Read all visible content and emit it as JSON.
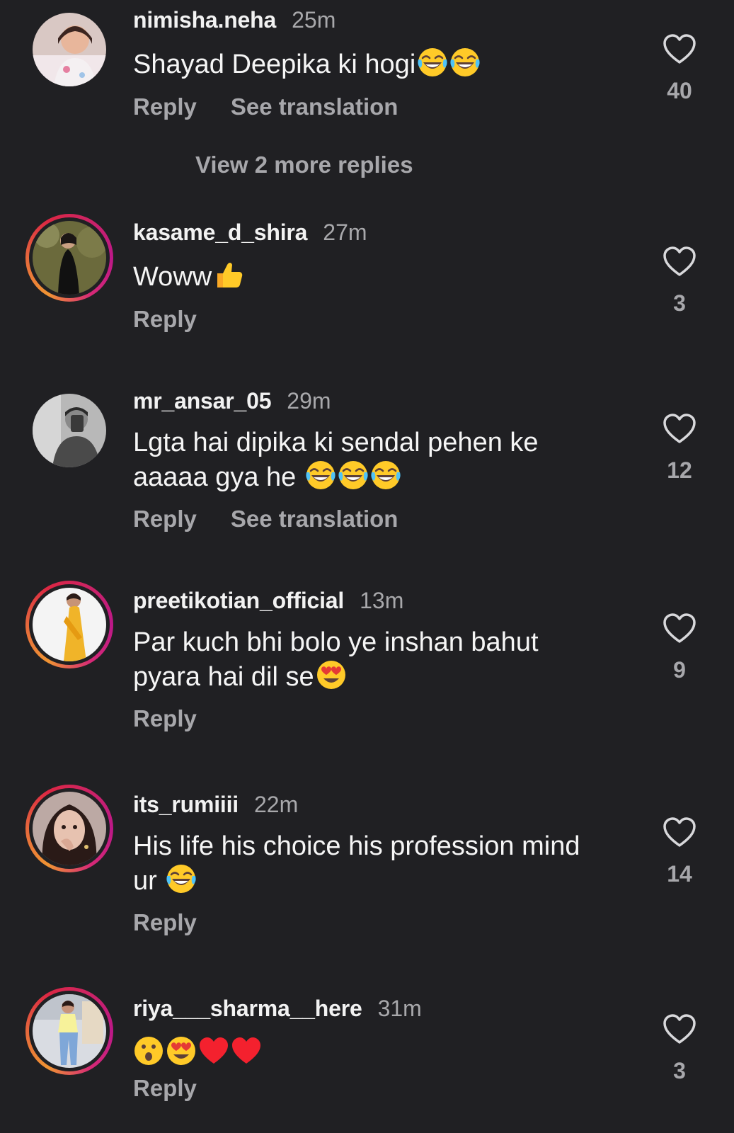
{
  "comments": [
    {
      "username": "nimisha.neha",
      "time": "25m",
      "text": "Shayad Deepika ki hogi",
      "emoji": [
        "face-with-tears-of-joy",
        "face-with-tears-of-joy"
      ],
      "reply": "Reply",
      "translate": "See translation",
      "likes": "40",
      "story_ring": false
    },
    {
      "username": "kasame_d_shira",
      "time": "27m",
      "text": "Woww",
      "emoji": [
        "thumbs-up"
      ],
      "reply": "Reply",
      "likes": "3",
      "story_ring": true
    },
    {
      "username": "mr_ansar_05",
      "time": "29m",
      "text_line1": "Lgta hai dipika ki sendal pehen ke",
      "text_line2": "aaaaa gya he ",
      "emoji": [
        "face-with-tears-of-joy",
        "face-with-tears-of-joy",
        "face-with-tears-of-joy"
      ],
      "reply": "Reply",
      "translate": "See translation",
      "likes": "12",
      "story_ring": false
    },
    {
      "username": "preetikotian_official",
      "time": "13m",
      "text_line1": "Par kuch bhi bolo ye inshan bahut",
      "text_line2": "pyara hai dil se",
      "emoji": [
        "smiling-face-with-heart-eyes"
      ],
      "reply": "Reply",
      "likes": "9",
      "story_ring": true
    },
    {
      "username": "its_rumiiii",
      "time": "22m",
      "text_line1": "His life his choice his profession mind",
      "text_line2": "ur ",
      "emoji": [
        "face-with-tears-of-joy"
      ],
      "reply": "Reply",
      "likes": "14",
      "story_ring": true
    },
    {
      "username": "riya___sharma__here",
      "time": "31m",
      "text": "",
      "emoji": [
        "face-with-open-mouth",
        "smiling-face-with-heart-eyes",
        "red-heart",
        "red-heart"
      ],
      "reply": "Reply",
      "likes": "3",
      "story_ring": true
    }
  ],
  "more_replies": "View 2 more replies",
  "colors": {
    "background": "#202023",
    "muted_text": "#a7a7ab",
    "story_ring_start": "#f09433",
    "story_ring_end": "#bc1888"
  }
}
